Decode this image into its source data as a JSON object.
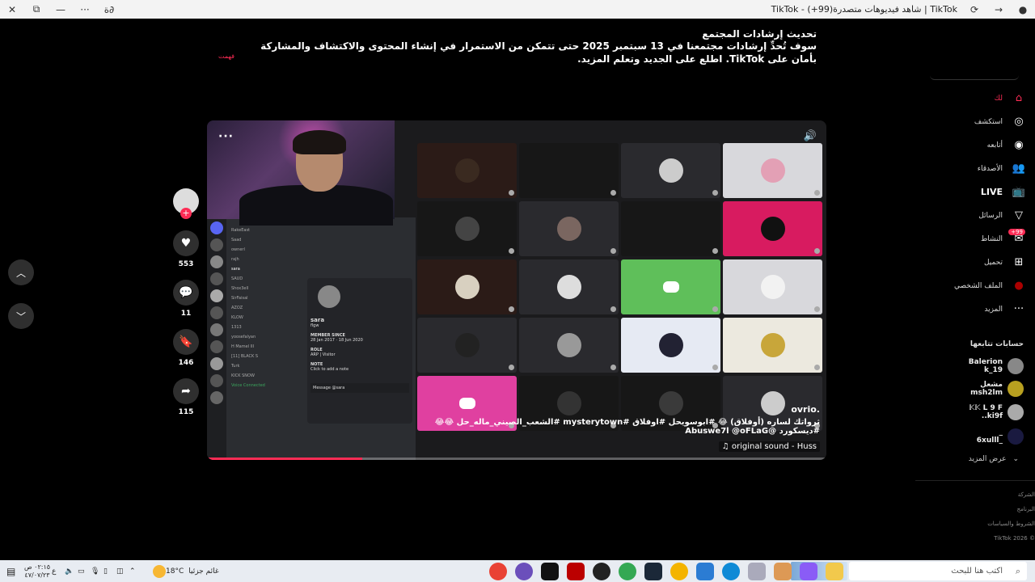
{
  "browser": {
    "tab_title": "TikTok | شاهد فيديوهات متصدرة(99+) - TikTok",
    "buttons": {
      "close": "✕",
      "restore": "⧉",
      "minimize": "—",
      "more": "···",
      "extra": "ة∂"
    }
  },
  "banner": {
    "title": "تحديث إرشادات المجتمع",
    "text": "سوف تُحدِّ إرشادات مجتمعنا في 13 سبتمبر 2025 حتى تتمكن من الاستمرار في إنشاء المحتوى والاكتشاف والمشاركة بأمان على TikTok. اطلع على الجديد وتعلم المزيد.",
    "dismiss": "فهمت"
  },
  "video": {
    "author": "ovrio.",
    "caption": "ثرواتك لساره (أوفلاق) 😂 #ابوسويحل #اوفلاق #mysterytown #الشعب_الصيني_ماله_حل 😂😂 #ديسكورد @Abuswe7l @oFLaG",
    "sound": "♫ original sound - Huss",
    "progress": 0.25,
    "discord": {
      "members": [
        "RakeEast",
        "Saad",
        "ownerl",
        "rajh",
        "sara",
        "SAUD",
        "Shox3ell",
        "SirFaisal",
        "AZOZ",
        "KLOW",
        "1313",
        "yoosefalyan",
        "H Mamel III",
        "[11] BLACK S",
        "Turk",
        "KICK SNOW"
      ],
      "profile": {
        "name": "sara",
        "tag": "flgw",
        "section_member_since": "MEMBER SINCE",
        "date1": "28 Jan 2017",
        "date2": "18 Jun 2020",
        "section_role": "ROLE",
        "role": "ARP | Visitor",
        "section_note": "NOTE",
        "note": "Click to add a note",
        "message": "Message @sara"
      },
      "voice_status": "Voice Connected"
    }
  },
  "actions": {
    "likes": "553",
    "comments": "11",
    "saves": "146",
    "shares": "115"
  },
  "sidebar": {
    "items": [
      {
        "label": "لك",
        "icon": "home-icon"
      },
      {
        "label": "استكشف",
        "icon": "compass-icon"
      },
      {
        "label": "أتابعه",
        "icon": "following-icon"
      },
      {
        "label": "الأصدقاء",
        "icon": "friends-icon"
      },
      {
        "label": "LIVE",
        "icon": "live-icon"
      },
      {
        "label": "الرسائل",
        "icon": "messages-icon"
      },
      {
        "label": "النشاط",
        "icon": "inbox-icon"
      },
      {
        "label": "تحميل",
        "icon": "upload-icon"
      },
      {
        "label": "الملف الشخصي",
        "icon": "profile-icon"
      },
      {
        "label": "المزيد",
        "icon": "more-icon"
      }
    ],
    "activity_badge": "99+",
    "following_title": "حسابات تتابعها",
    "following": [
      {
        "name": "Balerion",
        "handle": "19_k"
      },
      {
        "name": "مشعل",
        "handle": "msh2lm"
      },
      {
        "name": "𝕂𝕂 L 9 F",
        "handle": "ki9f.."
      },
      {
        "name": "_",
        "handle": "_6xulll"
      }
    ],
    "see_more": "عرض المزيد",
    "footer": [
      "الشركة",
      "البرنامج",
      "الشروط والسياسات",
      "© TikTok 2026"
    ]
  },
  "taskbar": {
    "search_placeholder": "اكتب هنا للبحث",
    "weather_text": "غائم جزئيا",
    "temperature": "18°C",
    "time": "٠٢:١٥ ص",
    "date": "٤٧/٠٧/٢٣",
    "lang": "ع"
  },
  "colors": {
    "accent": "#fe2c55",
    "background": "#000000"
  }
}
